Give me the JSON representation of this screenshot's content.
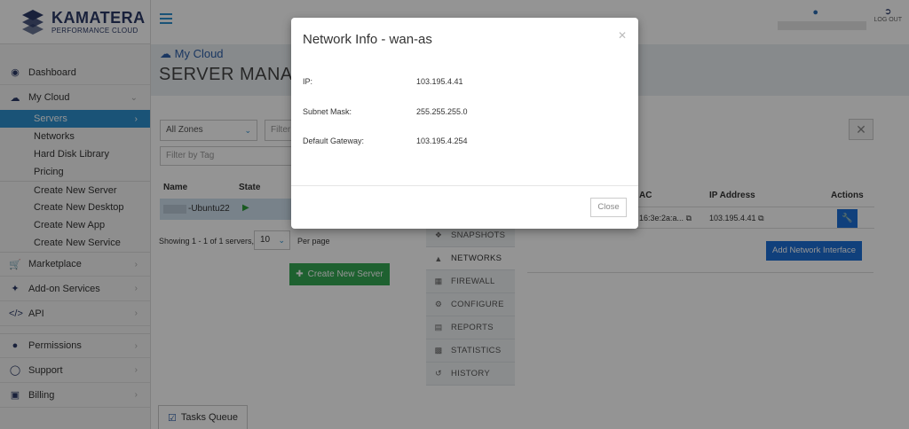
{
  "brand": {
    "name": "KAMATERA",
    "tagline": "PERFORMANCE CLOUD"
  },
  "topbar": {
    "logout_label": "LOG OUT"
  },
  "sidebar": {
    "items": [
      {
        "label": "Dashboard",
        "icon": "dashboard-icon"
      },
      {
        "label": "My Cloud",
        "icon": "cloud-icon"
      }
    ],
    "subitems": [
      "Servers",
      "Networks",
      "Hard Disk Library",
      "Pricing",
      "Create New Server",
      "Create New Desktop",
      "Create New App",
      "Create New Service"
    ],
    "items2": [
      {
        "label": "Marketplace",
        "icon": "cart-icon"
      },
      {
        "label": "Add-on Services",
        "icon": "puzzle-icon"
      },
      {
        "label": "API",
        "icon": "code-icon"
      },
      {
        "label": "Permissions",
        "icon": "users-icon"
      },
      {
        "label": "Support",
        "icon": "support-icon"
      },
      {
        "label": "Billing",
        "icon": "card-icon"
      }
    ]
  },
  "header": {
    "breadcrumb": "My Cloud",
    "title": "SERVER MANAG"
  },
  "filters": {
    "zone_value": "All Zones",
    "filter_placeholder": "Filter",
    "tag_placeholder": "Filter by Tag"
  },
  "server_table": {
    "headers": [
      "Name",
      "State"
    ],
    "rows": [
      {
        "name": "-Ubuntu22",
        "state": "running"
      }
    ]
  },
  "pagination": {
    "showing": "Showing 1 - 1 of 1 servers,",
    "per_page_value": "10",
    "per_page_label": "Per page"
  },
  "create_button": "Create New Server",
  "detail_tabs": [
    "SNAPSHOTS",
    "NETWORKS",
    "FIREWALL",
    "CONFIGURE",
    "REPORTS",
    "STATISTICS",
    "HISTORY"
  ],
  "network_table": {
    "headers": [
      "AC",
      "IP Address",
      "Actions"
    ],
    "row": {
      "mac": "16:3e:2a:a...",
      "ip": "103.195.4.41"
    }
  },
  "add_interface_button": "Add Network Interface",
  "tasks_queue": "Tasks Queue",
  "modal": {
    "title": "Network Info - wan-as",
    "fields": [
      {
        "label": "IP:",
        "value": "103.195.4.41"
      },
      {
        "label": "Subnet Mask:",
        "value": "255.255.255.0"
      },
      {
        "label": "Default Gateway:",
        "value": "103.195.4.254"
      }
    ],
    "close_label": "Close"
  },
  "colors": {
    "accent": "#2d8fce",
    "brand": "#2b3a67",
    "green": "#34a853",
    "blue_button": "#1d6fd6"
  }
}
